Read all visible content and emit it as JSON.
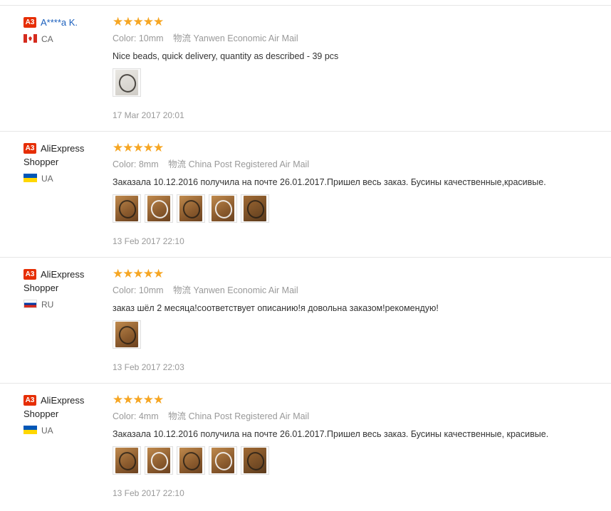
{
  "labels": {
    "color": "Color:",
    "ship_icon": "物流"
  },
  "reviews": [
    {
      "badge": "A3",
      "name": "A****a K.",
      "name_is_link": true,
      "country_code": "CA",
      "stars": "★★★★★",
      "color": "10mm",
      "shipping": "Yanwen Economic Air Mail",
      "text": "Nice beads, quick delivery, quantity as described - 39 pcs",
      "photos": [
        "grey"
      ],
      "date": "17 Mar 2017 20:01"
    },
    {
      "badge": "A3",
      "name": "AliExpress Shopper",
      "name_is_link": false,
      "country_code": "UA",
      "stars": "★★★★★",
      "color": "8mm",
      "shipping": "China Post Registered Air Mail",
      "text": "Заказала 10.12.2016 получила на почте 26.01.2017.Пришел весь заказ. Бусины качественные,красивые.",
      "photos": [
        "wood",
        "wood",
        "wood",
        "wood",
        "dark"
      ],
      "date": "13 Feb 2017 22:10"
    },
    {
      "badge": "A3",
      "name": "AliExpress Shopper",
      "name_is_link": false,
      "country_code": "RU",
      "stars": "★★★★★",
      "color": "10mm",
      "shipping": "Yanwen Economic Air Mail",
      "text": "заказ шёл 2 месяца!соответствует описанию!я довольна заказом!рекомендую!",
      "photos": [
        "wood"
      ],
      "date": "13 Feb 2017 22:03"
    },
    {
      "badge": "A3",
      "name": "AliExpress Shopper",
      "name_is_link": false,
      "country_code": "UA",
      "stars": "★★★★★",
      "color": "4mm",
      "shipping": "China Post Registered Air Mail",
      "text": "Заказала 10.12.2016 получила на почте 26.01.2017.Пришел весь заказ. Бусины качественные, красивые.",
      "photos": [
        "wood",
        "wood",
        "wood",
        "wood",
        "dark"
      ],
      "date": "13 Feb 2017 22:10"
    }
  ]
}
